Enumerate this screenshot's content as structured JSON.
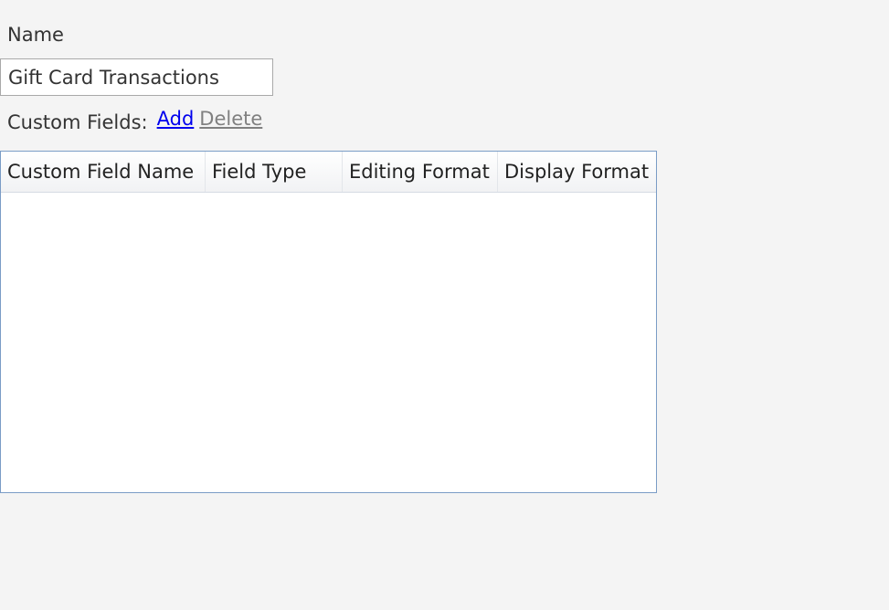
{
  "form": {
    "name_label": "Name",
    "name_value": "Gift Card Transactions",
    "custom_fields_label": "Custom Fields:",
    "add_link": "Add",
    "delete_link": "Delete"
  },
  "grid": {
    "columns": [
      "Custom Field Name",
      "Field Type",
      "Editing Format",
      "Display Format"
    ],
    "rows": []
  },
  "colors": {
    "background": "#f4f4f4",
    "link": "#0000ee",
    "disabled_link": "#808080",
    "grid_border": "#7a9cc6"
  }
}
